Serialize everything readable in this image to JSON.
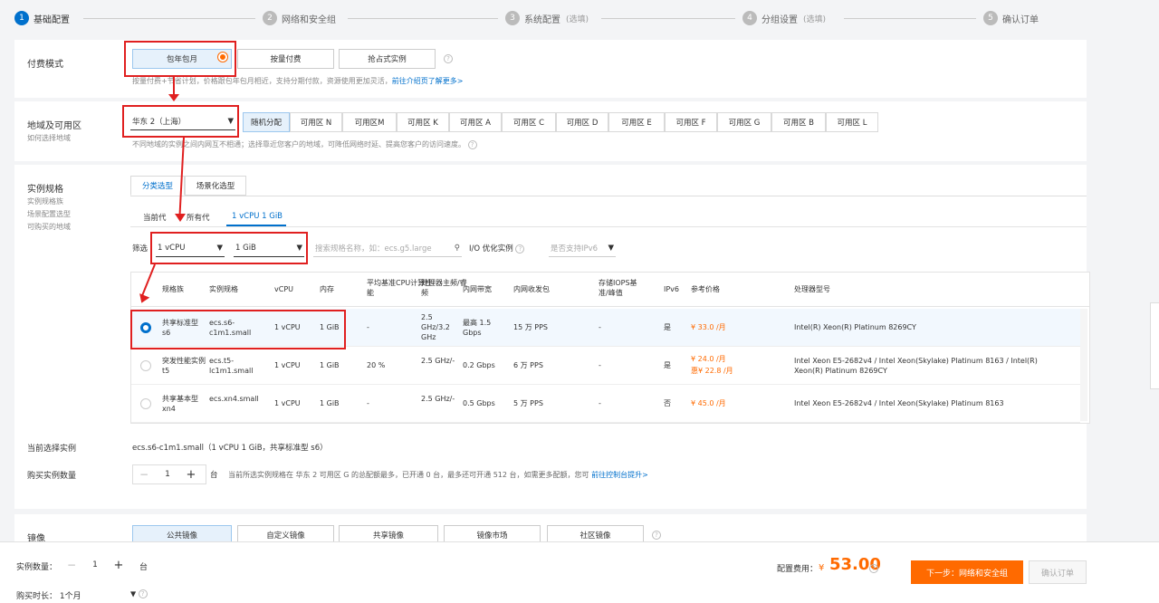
{
  "steps": [
    {
      "num": "1",
      "label": "基础配置",
      "opt": ""
    },
    {
      "num": "2",
      "label": "网络和安全组",
      "opt": ""
    },
    {
      "num": "3",
      "label": "系统配置",
      "opt": "(选填)"
    },
    {
      "num": "4",
      "label": "分组设置",
      "opt": "(选填)"
    },
    {
      "num": "5",
      "label": "确认订单",
      "opt": ""
    }
  ],
  "billing": {
    "title": "付费模式",
    "options": [
      "包年包月",
      "按量付费",
      "抢占式实例"
    ],
    "hint": "按量付费+节省计划，价格跟包年包月相近，支持分期付款，资源使用更加灵活，",
    "hint_link": "前往介绍页了解更多>"
  },
  "region": {
    "title": "地域及可用区",
    "sub": "如何选择地域",
    "selected": "华东 2（上海）",
    "zones": [
      "随机分配",
      "可用区 N",
      "可用区M",
      "可用区 K",
      "可用区 A",
      "可用区 C",
      "可用区 D",
      "可用区 E",
      "可用区 F",
      "可用区 G",
      "可用区 B",
      "可用区 L"
    ],
    "hint": "不同地域的实例之间内网互不相通；选择靠近您客户的地域，可降低网络时延、提高您客户的访问速度。"
  },
  "spec": {
    "title": "实例规格",
    "subs": [
      "实例规格族",
      "场景配置选型",
      "可购买的地域"
    ],
    "tabs": [
      "分类选型",
      "场景化选型"
    ],
    "subtabs": [
      "当前代",
      "所有代",
      "1 vCPU 1 GiB"
    ],
    "filter_label": "筛选",
    "vcpu": "1 vCPU",
    "mem": "1 GiB",
    "search_placeholder": "搜索规格名称，如：ecs.g5.large",
    "io_label": "I/O 优化实例",
    "ipv6_label": "是否支持IPv6",
    "headers": [
      "规格族",
      "实例规格",
      "vCPU",
      "内存",
      "平均基准CPU计算性能",
      "处理器主频/睿频",
      "内网带宽",
      "内网收发包",
      "存储IOPS基准/峰值",
      "IPv6",
      "参考价格",
      "处理器型号"
    ],
    "rows": [
      {
        "family": "共享标准型 s6",
        "spec": "ecs.s6-c1m1.small",
        "vcpu": "1 vCPU",
        "mem": "1 GiB",
        "perf": "-",
        "freq": "2.5 GHz/3.2 GHz",
        "bw": "最高 1.5 Gbps",
        "pps": "15 万 PPS",
        "iops": "-",
        "ipv6": "是",
        "price": "¥ 33.0 /月",
        "price2": "",
        "cpu": "Intel(R) Xeon(R) Platinum 8269CY"
      },
      {
        "family": "突发性能实例 t5",
        "spec": "ecs.t5-lc1m1.small",
        "vcpu": "1 vCPU",
        "mem": "1 GiB",
        "perf": "20 %",
        "freq": "2.5 GHz/-",
        "bw": "0.2 Gbps",
        "pps": "6 万 PPS",
        "iops": "-",
        "ipv6": "是",
        "price": "¥ 24.0 /月",
        "price2": "惠¥ 22.8 /月",
        "cpu": "Intel Xeon E5-2682v4 / Intel Xeon(Skylake) Platinum 8163 / Intel(R) Xeon(R) Platinum 8269CY"
      },
      {
        "family": "共享基本型 xn4",
        "spec": "ecs.xn4.small",
        "vcpu": "1 vCPU",
        "mem": "1 GiB",
        "perf": "-",
        "freq": "2.5 GHz/-",
        "bw": "0.5 Gbps",
        "pps": "5 万 PPS",
        "iops": "-",
        "ipv6": "否",
        "price": "¥ 45.0 /月",
        "price2": "",
        "cpu": "Intel Xeon E5-2682v4 / Intel Xeon(Skylake) Platinum 8163"
      }
    ],
    "current_label": "当前选择实例",
    "current_value": "ecs.s6-c1m1.small（1 vCPU 1 GiB，共享标准型 s6）",
    "qty_label": "购买实例数量",
    "qty": "1",
    "qty_unit": "台",
    "qty_hint": "当前所选实例规格在 华东 2 可用区 G 的总配额最多，已开通 0 台，最多还可开通 512 台，如需更多配额，您可",
    "qty_link": "前往控制台提升>"
  },
  "image": {
    "title": "镜像",
    "options": [
      "公共镜像",
      "自定义镜像",
      "共享镜像",
      "镜像市场",
      "社区镜像"
    ]
  },
  "footer": {
    "count_label": "实例数量：",
    "count": "1",
    "count_unit": "台",
    "duration_label": "购买时长：",
    "duration": "1个月",
    "fee_label": "配置费用：",
    "fee_symbol": "¥",
    "fee": "53.00",
    "next": "下一步：网络和安全组",
    "confirm": "确认订单"
  },
  "colors": {
    "accent": "#0070cc",
    "orange": "#ff6a00",
    "annotation": "#e02020"
  }
}
